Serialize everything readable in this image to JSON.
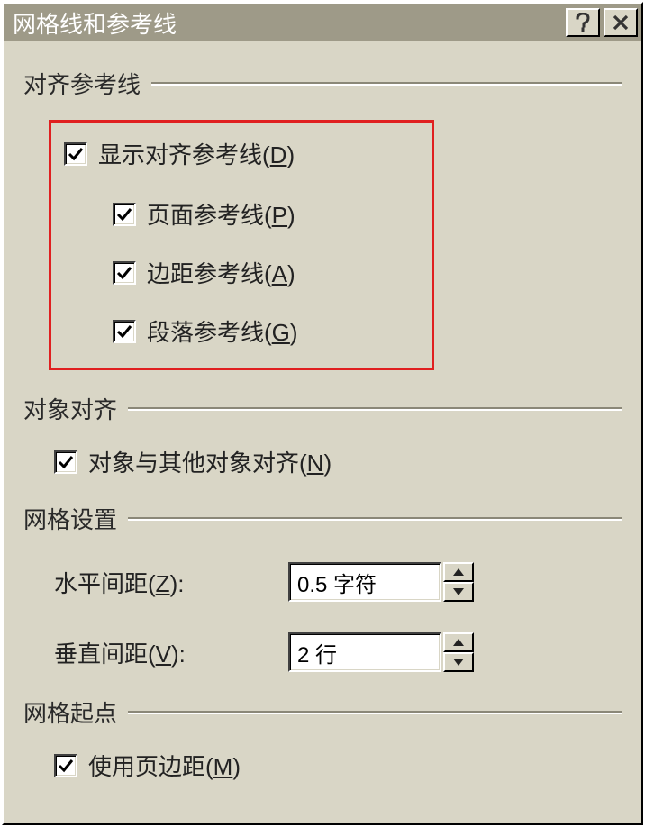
{
  "titlebar": {
    "title": "网格线和参考线"
  },
  "groups": {
    "alignGuides": {
      "legend": "对齐参考线",
      "showGuides": {
        "text": "显示对齐参考线(",
        "accel": "D",
        "tail": ")",
        "checked": true
      },
      "pageGuides": {
        "text": "页面参考线(",
        "accel": "P",
        "tail": ")",
        "checked": true
      },
      "marginGuides": {
        "text": "边距参考线(",
        "accel": "A",
        "tail": ")",
        "checked": true
      },
      "paragraphGuides": {
        "text": "段落参考线(",
        "accel": "G",
        "tail": ")",
        "checked": true
      }
    },
    "objectAlign": {
      "legend": "对象对齐",
      "snapObjects": {
        "text": "对象与其他对象对齐(",
        "accel": "N",
        "tail": ")",
        "checked": true
      }
    },
    "gridSettings": {
      "legend": "网格设置",
      "hSpacing": {
        "label": "水平间距(",
        "accel": "Z",
        "labelTail": "):",
        "value": "0.5 字符"
      },
      "vSpacing": {
        "label": "垂直间距(",
        "accel": "V",
        "labelTail": "):",
        "value": "2 行"
      }
    },
    "gridOrigin": {
      "legend": "网格起点",
      "useMargins": {
        "text": "使用页边距(",
        "accel": "M",
        "tail": ")",
        "checked": true
      }
    }
  }
}
